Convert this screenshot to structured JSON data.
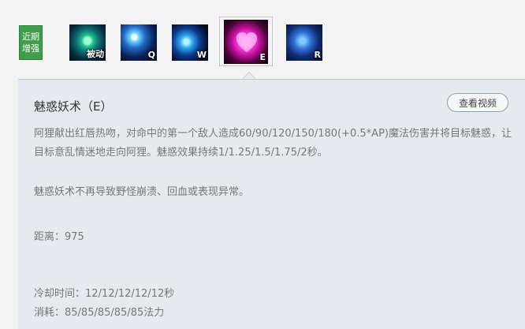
{
  "skill_bar": {
    "recent_label_line1": "近期",
    "recent_label_line2": "增强",
    "skills": [
      {
        "key": "被动",
        "icon": "passive-skill-icon"
      },
      {
        "key": "Q",
        "icon": "q-skill-icon"
      },
      {
        "key": "W",
        "icon": "w-skill-icon"
      },
      {
        "key": "E",
        "icon": "e-skill-heart-icon",
        "active": true
      },
      {
        "key": "R",
        "icon": "r-skill-icon"
      }
    ]
  },
  "detail": {
    "title": "魅惑妖术（E）",
    "video_button": "查看视频",
    "description": "阿狸献出红唇热吻，对命中的第一个敌人造成60/90/120/150/180(+0.5*AP)魔法伤害并将目标魅惑，让目标意乱情迷地走向阿狸。魅惑效果持续1/1.25/1.5/1.75/2秒。",
    "note": "魅惑妖术不再导致野怪崩溃、回血或表现异常。",
    "range": "距离：975",
    "cooldown": "冷却时间：12/12/12/12/12秒",
    "cost": "消耗：85/85/85/85/85法力"
  },
  "colors": {
    "recent_badge": "#3f9e49",
    "panel_bg": "#e6e9ee",
    "page_bg": "#f3f3f3",
    "text_muted": "#777777"
  }
}
